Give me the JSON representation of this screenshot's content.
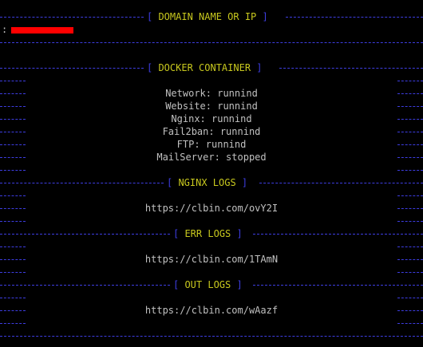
{
  "sections": {
    "domain_title": "DOMAIN NAME OR IP",
    "docker_title": "DOCKER CONTAINER",
    "nginx_logs_title": "NGINX LOGS",
    "err_logs_title": "ERR LOGS",
    "out_logs_title": "OUT LOGS"
  },
  "domain": {
    "prompt": ":"
  },
  "docker": {
    "network": "Network: runnind",
    "website": "Website: runnind",
    "nginx": "Nginx: runnind",
    "fail2ban": "Fail2ban: runnind",
    "ftp": "FTP: runnind",
    "mailserver": "MailServer: stopped"
  },
  "logs": {
    "nginx_url": "https://clbin.com/ovY2I",
    "err_url": "https://clbin.com/1TAmN",
    "out_url": "https://clbin.com/wAazf"
  },
  "colors": {
    "dash": "#3d3de0",
    "title": "#c8c81e",
    "text": "#c0c0c0",
    "redact": "#ff0000"
  }
}
